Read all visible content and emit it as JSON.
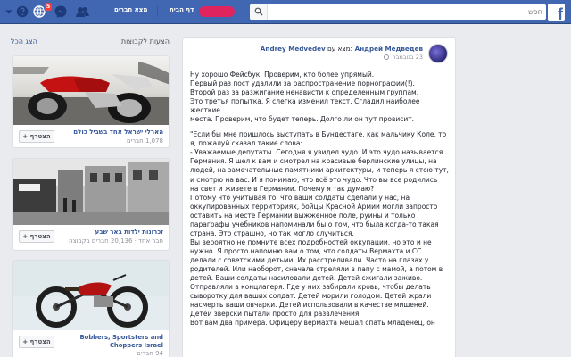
{
  "topbar": {
    "search_placeholder": "חפש",
    "home_label": "דף הבית",
    "friends_label": "מצא חברים",
    "notification_count": "5",
    "logo_letter": "f"
  },
  "sidebar": {
    "title": "הצעות לקבוצות",
    "hide_label": "הצג הכל",
    "join_label": "+ הצטרף",
    "groups": [
      {
        "name": "הארלי ישראל אחד בשביל כולם",
        "members": "1,078 חברים"
      },
      {
        "name": "זכרונות ילדות באר שבע",
        "members": "חבר אחד · 20,136 חברים בקבוצה"
      },
      {
        "name": "Bobbers, Sportsters and Choppers Israel",
        "members": "‏94 חברים"
      }
    ]
  },
  "post": {
    "author": "Андрей Медведев",
    "with_text": " נמצא עם ",
    "tagged": "Andrey Medvedev",
    "time": "23 בנובמבר",
    "lines": [
      "Ну хорошо Фейсбук. Проверим, кто более упрямый.",
      "Первый раз пост удалили за распространение порнографии(!).",
      "Второй раз за разжигание ненависти к определенным группам.",
      "Это третья попытка. Я слегка изменил текст. Сгладил наиболее жесткие",
      "места. Проверим, что будет теперь. Долго ли он тут провисит.",
      "\"Если бы мне пришлось выступать в Бундестаге, как мальчику Коле, то",
      "я, пожалуй сказал такие слова:",
      "- Уважаемые депутаты. Сегодня я увидел чудо. И это чудо называется",
      "Германия. Я шел к вам и смотрел на красивые берлинские улицы, на",
      "людей, на замечательные памятники архитектуры, и теперь я стою тут,",
      "и смотрю на вас. И я понимаю, что всё это чудо. Что вы все родились",
      "на свет и живете в Германии. Почему я так думаю?",
      "Потому что учитывая то, что ваши солдаты сделали у нас, на",
      "оккупированных территориях, бойцы Красной Армии могли запросто",
      "оставить на месте Германии выжженное поле, руины и только",
      "параграфы учебников напоминали бы о том, что была когда-то такая",
      "страна. Это страшно, но так могло случиться.",
      "Вы вероятно не помните всех подробностей оккупации, но это и не",
      "нужно. Я просто напомню вам о том, что солдаты Вермахта и СС",
      "делали с советскими детьми. Их расстреливали. Часто на глазах у",
      "родителей. Или наоборот, сначала стреляли в папу с мамой, а потом в",
      "детей. Ваши солдаты насиловали детей. Детей сжигали заживо.",
      "Отправляли в концлагеря. Где у них забирали кровь, чтобы делать",
      "сыворотку для ваших солдат. Детей морили голодом. Детей жрали",
      "насмерть ваши овчарки. Детей использовали в качестве мишеней.",
      "Детей зверски пытали просто для развлечения.",
      "Вот вам два примера. Офицеру вермахта мешал спать младенец, он"
    ]
  }
}
